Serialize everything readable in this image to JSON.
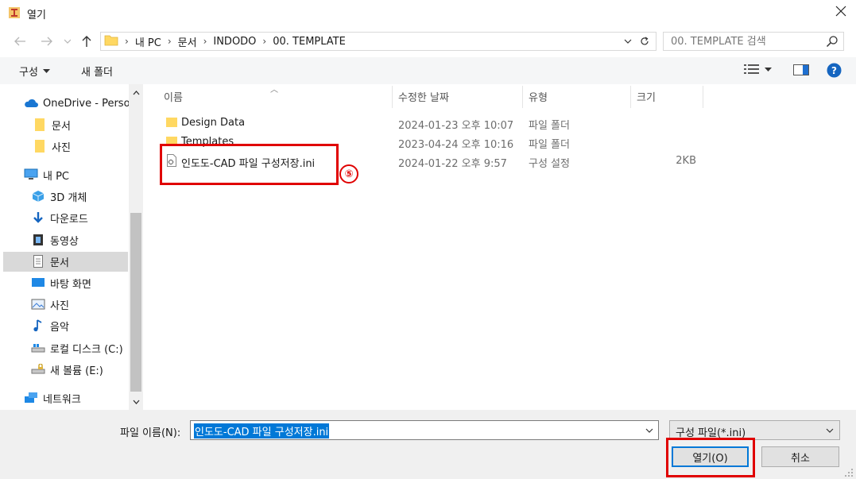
{
  "window": {
    "title": "열기",
    "close_glyph": "✕"
  },
  "nav": {
    "breadcrumb": [
      "내 PC",
      "문서",
      "INDODO",
      "00. TEMPLATE"
    ],
    "search_placeholder": "00. TEMPLATE 검색"
  },
  "toolbar": {
    "organize_label": "구성",
    "new_folder_label": "새 폴더"
  },
  "sidebar": {
    "items": [
      {
        "label": "OneDrive - Personal",
        "icon": "cloud-icon"
      },
      {
        "label": "문서",
        "icon": "folder-icon"
      },
      {
        "label": "사진",
        "icon": "folder-icon"
      },
      {
        "label": "내 PC",
        "icon": "computer-icon"
      },
      {
        "label": "3D 개체",
        "icon": "cube-icon"
      },
      {
        "label": "다운로드",
        "icon": "download-icon"
      },
      {
        "label": "동영상",
        "icon": "film-icon"
      },
      {
        "label": "문서",
        "icon": "document-icon",
        "selected": true
      },
      {
        "label": "바탕 화면",
        "icon": "desktop-icon"
      },
      {
        "label": "사진",
        "icon": "picture-icon"
      },
      {
        "label": "음악",
        "icon": "music-icon"
      },
      {
        "label": "로컬 디스크 (C:)",
        "icon": "drive-icon"
      },
      {
        "label": "새 볼륨 (E:)",
        "icon": "drive-icon"
      },
      {
        "label": "네트워크",
        "icon": "network-icon"
      }
    ]
  },
  "columns": [
    "이름",
    "수정한 날짜",
    "유형",
    "크기"
  ],
  "files": [
    {
      "name": "Design Data",
      "date": "2024-01-23 오후 10:07",
      "type": "파일 폴더",
      "size": "",
      "icon": "folder-icon"
    },
    {
      "name": "Templates",
      "date": "2023-04-24 오후 10:16",
      "type": "파일 폴더",
      "size": "",
      "icon": "folder-icon"
    },
    {
      "name": "인도도-CAD 파일 구성저장.ini",
      "date": "2024-01-22 오후 9:57",
      "type": "구성 설정",
      "size": "2KB",
      "icon": "settings-file-icon"
    }
  ],
  "annotation": {
    "step_number": "⑤",
    "color": "#e00000"
  },
  "footer": {
    "filename_label": "파일 이름(N):",
    "filename_value": "인도도-CAD 파일 구성저장.ini",
    "filetype_value": "구성 파일(*.ini)",
    "open_label": "열기(O)",
    "cancel_label": "취소"
  },
  "colors": {
    "accent": "#0078d7",
    "folder": "#ffd862",
    "annotation": "#e00000"
  }
}
